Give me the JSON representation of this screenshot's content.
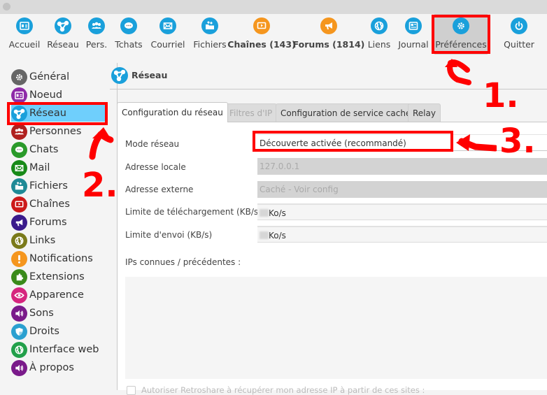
{
  "toolbar": {
    "items": [
      {
        "id": "accueil",
        "label": "Accueil",
        "icon": "home-card-icon",
        "color": "#1aa0db",
        "bold": false
      },
      {
        "id": "reseau",
        "label": "Réseau",
        "icon": "network-icon",
        "color": "#1aa0db",
        "bold": false
      },
      {
        "id": "pers",
        "label": "Pers.",
        "icon": "people-icon",
        "color": "#1aa0db",
        "bold": false
      },
      {
        "id": "tchats",
        "label": "Tchats",
        "icon": "chat-icon",
        "color": "#1aa0db",
        "bold": false
      },
      {
        "id": "courriel",
        "label": "Courriel",
        "icon": "mail-icon",
        "color": "#1aa0db",
        "bold": false
      },
      {
        "id": "fichiers",
        "label": "Fichiers",
        "icon": "folder-icon",
        "color": "#1aa0db",
        "bold": false
      },
      {
        "id": "chaines",
        "label": "Chaînes (143)",
        "icon": "channel-icon",
        "color": "#f5961e",
        "bold": true
      },
      {
        "id": "forums",
        "label": "Forums (1814)",
        "icon": "megaphone-icon",
        "color": "#f5961e",
        "bold": true
      },
      {
        "id": "liens",
        "label": "Liens",
        "icon": "globe-icon",
        "color": "#1aa0db",
        "bold": false
      },
      {
        "id": "journal",
        "label": "Journal",
        "icon": "newspaper-icon",
        "color": "#1aa0db",
        "bold": false
      },
      {
        "id": "preferences",
        "label": "Préférences",
        "icon": "gear-icon",
        "color": "#1aa0db",
        "bold": false
      },
      {
        "id": "quitter",
        "label": "Quitter",
        "icon": "power-icon",
        "color": "#1aa0db",
        "bold": false
      }
    ],
    "active": "preferences"
  },
  "sidebar": {
    "items": [
      {
        "label": "Général",
        "icon": "gear-icon",
        "color": "#666666"
      },
      {
        "label": "Noeud",
        "icon": "id-card-icon",
        "color": "#8e2aa8"
      },
      {
        "label": "Réseau",
        "icon": "network-icon",
        "color": "#1aa0db"
      },
      {
        "label": "Personnes",
        "icon": "people-icon",
        "color": "#b0201e"
      },
      {
        "label": "Chats",
        "icon": "chat-icon",
        "color": "#2a9a2a"
      },
      {
        "label": "Mail",
        "icon": "mail-icon",
        "color": "#188a18"
      },
      {
        "label": "Fichiers",
        "icon": "folder-icon",
        "color": "#1f8a96"
      },
      {
        "label": "Chaînes",
        "icon": "channel-icon",
        "color": "#cc1a1a"
      },
      {
        "label": "Forums",
        "icon": "megaphone-icon",
        "color": "#3a1a8c"
      },
      {
        "label": "Links",
        "icon": "globe-icon",
        "color": "#7a7a1a"
      },
      {
        "label": "Notifications",
        "icon": "exclamation-icon",
        "color": "#f5961e"
      },
      {
        "label": "Extensions",
        "icon": "puzzle-icon",
        "color": "#3a8a1a"
      },
      {
        "label": "Apparence",
        "icon": "eye-icon",
        "color": "#d6257e"
      },
      {
        "label": "Sons",
        "icon": "speaker-icon",
        "color": "#7a1a8a"
      },
      {
        "label": "Droits",
        "icon": "shield-icon",
        "color": "#2aa0d0"
      },
      {
        "label": "Interface web",
        "icon": "globe-icon",
        "color": "#22a04a"
      },
      {
        "label": "À propos",
        "icon": "speaker-icon",
        "color": "#7a1a8a"
      }
    ],
    "active": "Réseau"
  },
  "page": {
    "title": "Réseau",
    "tabs": [
      {
        "label": "Configuration du réseau",
        "state": "active"
      },
      {
        "label": "Filtres d'IP",
        "state": "disabled"
      },
      {
        "label": "Configuration de service caché",
        "state": "normal"
      },
      {
        "label": "Relay",
        "state": "normal"
      }
    ],
    "form": {
      "mode_label": "Mode réseau",
      "mode_value": "Découverte activée (recommandé)",
      "local_label": "Adresse locale",
      "local_value": "127.0.0.1",
      "external_label": "Adresse externe",
      "external_value": "Caché - Voir config",
      "download_label": "Limite de téléchargement (KB/s)",
      "download_suffix": "Ko/s",
      "upload_label": "Limite d'envoi (KB/s)",
      "upload_suffix": "Ko/s",
      "known_ips_label": "IPs connues / précédentes :",
      "allow_ip_label": "Autoriser Retroshare à récupérer mon adresse IP à partir de ces sites :"
    }
  },
  "annotations": {
    "step1": "1.",
    "step2": "2.",
    "step3": "3.",
    "color": "#ff0000"
  }
}
